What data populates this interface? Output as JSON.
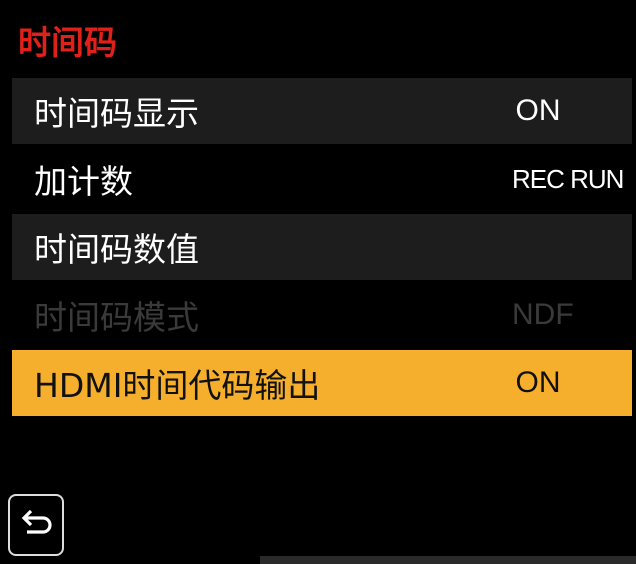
{
  "menu": {
    "title": "时间码",
    "items": [
      {
        "label": "时间码显示",
        "value": "ON"
      },
      {
        "label": "加计数",
        "value": "REC RUN"
      },
      {
        "label": "时间码数值",
        "value": ""
      },
      {
        "label": "时间码模式",
        "value": "NDF"
      },
      {
        "label": "HDMI时间代码输出",
        "value": "ON"
      }
    ]
  },
  "back_button": {
    "icon": "back-arrow-icon"
  },
  "colors": {
    "title": "#e0201a",
    "highlight": "#f6ae2d",
    "row_alt": "#1d1d1d",
    "disabled": "#3a3a3a"
  }
}
